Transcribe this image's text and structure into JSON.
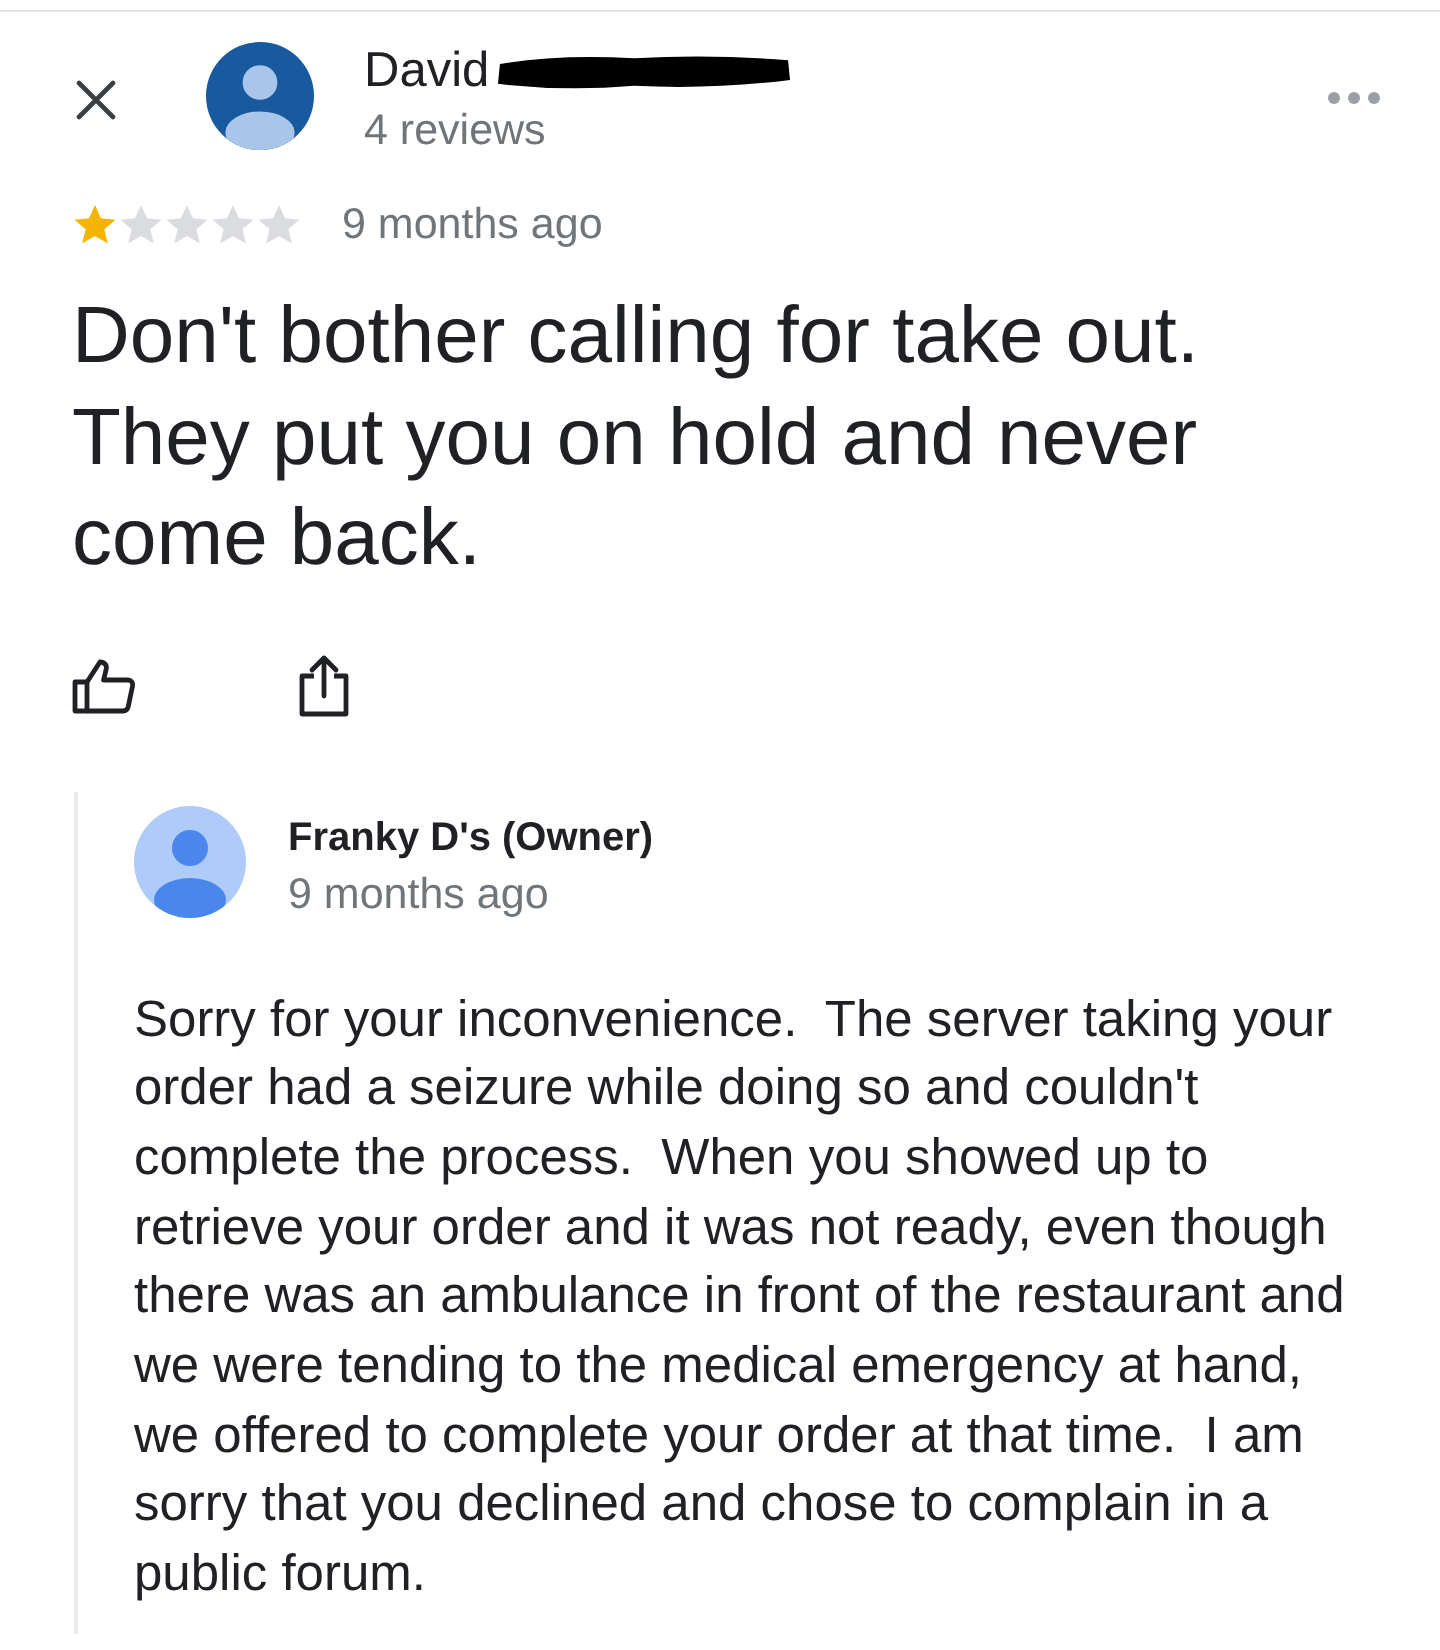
{
  "reviewer": {
    "name": "David",
    "redacted": true,
    "review_count": "4 reviews"
  },
  "review": {
    "stars": 1,
    "time": "9 months ago",
    "text": "Don't bother calling for take out. They put you on hold and never come back."
  },
  "owner_reply": {
    "name": "Franky D's (Owner)",
    "time": "9 months ago",
    "text": "Sorry for your inconvenience.  The server taking your order had a seizure while doing so and couldn't complete the process.  When you showed up to retrieve your order and it was not ready, even though there was an ambulance in front of the restaurant and we were tending to the medical emergency at hand, we offered to complete your order at that time.  I am sorry that you declined and chose to complain in a public forum."
  }
}
